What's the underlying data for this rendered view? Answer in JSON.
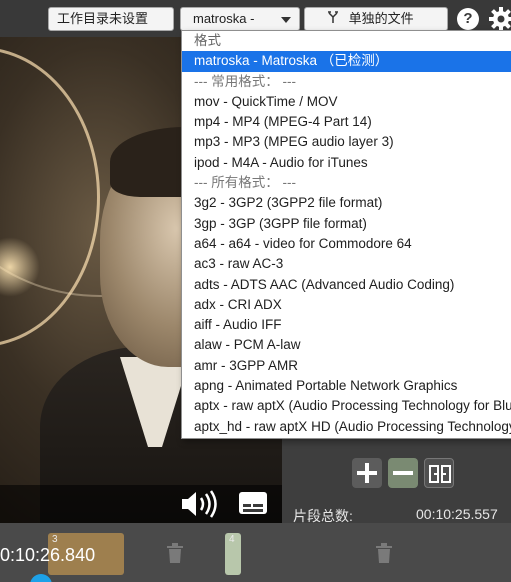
{
  "toolbar": {
    "workdir_label": "工作目录未设置",
    "format_value": "matroska -",
    "separate_files_label": "单独的文件",
    "help_label": "?"
  },
  "icons": {
    "separate": "split-arrows-icon",
    "help": "help-icon",
    "settings": "gear-icon",
    "volume": "volume-icon",
    "subtitle": "subtitle-icon",
    "add": "plus-icon",
    "remove": "minus-icon",
    "split": "split-segments-icon",
    "trash": "trash-icon"
  },
  "format_dropdown": {
    "items": [
      "格式",
      "matroska - Matroska （已检测）",
      "--- 常用格式： ---",
      "mov - QuickTime / MOV",
      "mp4 - MP4 (MPEG-4 Part 14)",
      "mp3 - MP3 (MPEG audio layer 3)",
      "ipod - M4A - Audio for iTunes",
      "--- 所有格式： ---",
      "3g2 - 3GP2 (3GPP2 file format)",
      "3gp - 3GP (3GPP file format)",
      "a64 - a64 - video for Commodore 64",
      "ac3 - raw AC-3",
      "adts - ADTS AAC (Advanced Audio Coding)",
      "adx - CRI ADX",
      "aiff - Audio IFF",
      "alaw - PCM A-law",
      "amr - 3GPP AMR",
      "apng - Animated Portable Network Graphics",
      "aptx - raw aptX (Audio Processing Technology for Bluetooth)",
      "aptx_hd - raw aptX HD (Audio Processing Technology for Bluetooth)"
    ],
    "selected_index": 1
  },
  "segments": {
    "total_label": "片段总数:",
    "total_value": "00:10:25.557",
    "seg3_num": "3",
    "seg4_num": "4"
  },
  "timeline": {
    "current_time": "0:10:26.840"
  },
  "colors": {
    "accent": "#1a73e8",
    "segment_3": "#9e7f4e",
    "segment_4": "#b8c7ab",
    "playhead": "#1da1e8"
  }
}
